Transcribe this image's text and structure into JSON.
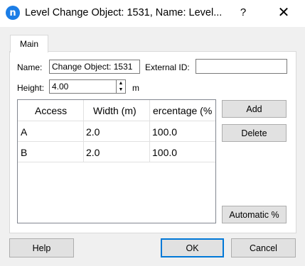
{
  "window": {
    "icon_letter": "n",
    "title": "Level Change Object: 1531, Name: Level...",
    "help_glyph": "?",
    "close_glyph": "✕"
  },
  "tabs": [
    {
      "label": "Main"
    }
  ],
  "form": {
    "name_label": "Name:",
    "name_value": "Change Object: 1531",
    "external_id_label": "External ID:",
    "external_id_value": "",
    "height_label": "Height:",
    "height_value": "4.00",
    "height_unit": "m"
  },
  "table": {
    "headers": [
      "Access",
      "Width (m)",
      "ercentage (%"
    ],
    "rows": [
      [
        "A",
        "2.0",
        "100.0"
      ],
      [
        "B",
        "2.0",
        "100.0"
      ]
    ]
  },
  "buttons": {
    "add": "Add",
    "delete": "Delete",
    "automatic": "Automatic %",
    "help": "Help",
    "ok": "OK",
    "cancel": "Cancel"
  },
  "colors": {
    "accent": "#0078d7",
    "app_icon": "#1b7de6"
  }
}
